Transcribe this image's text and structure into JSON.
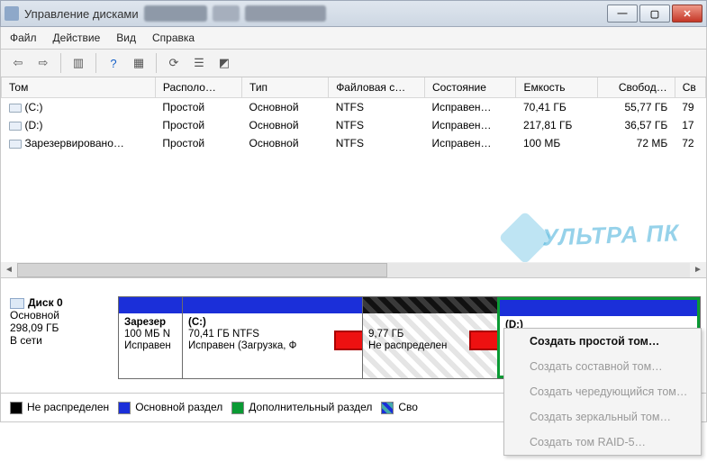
{
  "window": {
    "title": "Управление дисками"
  },
  "menu": {
    "file": "Файл",
    "action": "Действие",
    "view": "Вид",
    "help": "Справка"
  },
  "columns": {
    "volume": "Том",
    "layout": "Располо…",
    "type": "Тип",
    "fs": "Файловая с…",
    "state": "Состояние",
    "capacity": "Емкость",
    "free": "Свобод…",
    "pct": "Св"
  },
  "rows": [
    {
      "name": "(C:)",
      "layout": "Простой",
      "type": "Основной",
      "fs": "NTFS",
      "state": "Исправен…",
      "capacity": "70,41 ГБ",
      "free": "55,77 ГБ",
      "pct": "79"
    },
    {
      "name": "(D:)",
      "layout": "Простой",
      "type": "Основной",
      "fs": "NTFS",
      "state": "Исправен…",
      "capacity": "217,81 ГБ",
      "free": "36,57 ГБ",
      "pct": "17"
    },
    {
      "name": "Зарезервировано…",
      "layout": "Простой",
      "type": "Основной",
      "fs": "NTFS",
      "state": "Исправен…",
      "capacity": "100 МБ",
      "free": "72 МБ",
      "pct": "72"
    }
  ],
  "watermark": "УЛЬТРА ПК",
  "disk": {
    "label": "Диск 0",
    "type": "Основной",
    "size": "298,09 ГБ",
    "status": "В сети"
  },
  "parts": {
    "reserved": {
      "title": "Зарезер",
      "size": "100 МБ N",
      "state": "Исправен"
    },
    "c": {
      "title": "(C:)",
      "size": "70,41 ГБ NTFS",
      "state": "Исправен (Загрузка, Ф"
    },
    "unalloc": {
      "size": "9,77 ГБ",
      "state": "Не распределен"
    },
    "d": {
      "title": "(D:)"
    }
  },
  "context": {
    "simple": "Создать простой том…",
    "spanned": "Создать составной том…",
    "striped": "Создать чередующийся том…",
    "mirror": "Создать зеркальный том…",
    "raid5": "Создать том RAID-5…"
  },
  "legend": {
    "unalloc": "Не распределен",
    "primary": "Основной раздел",
    "extended": "Дополнительный раздел",
    "free": "Сво"
  }
}
